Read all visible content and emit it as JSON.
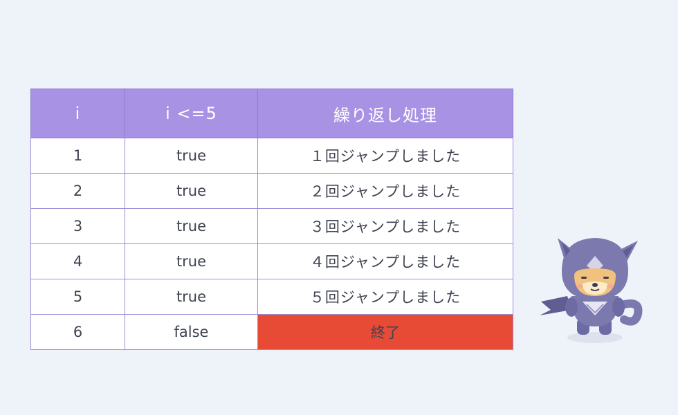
{
  "table": {
    "headers": [
      "i",
      "i <=5",
      "繰り返し処理"
    ],
    "rows": [
      {
        "i": "1",
        "condition": "true",
        "result": "１回ジャンプしました"
      },
      {
        "i": "2",
        "condition": "true",
        "result": "２回ジャンプしました"
      },
      {
        "i": "3",
        "condition": "true",
        "result": "３回ジャンプしました"
      },
      {
        "i": "4",
        "condition": "true",
        "result": "４回ジャンプしました"
      },
      {
        "i": "5",
        "condition": "true",
        "result": "５回ジャンプしました"
      },
      {
        "i": "6",
        "condition": "false",
        "result": "終了"
      }
    ]
  },
  "colors": {
    "background": "#eef3fa",
    "header": "#a892e3",
    "true_text": "#3f4350",
    "result_text": "#4bb6df",
    "false_text": "#e44a37",
    "end_fill": "#e74a35",
    "mascot_body": "#7b79ad"
  },
  "mascot": {
    "icon": "ninja-dog-mascot-icon"
  }
}
